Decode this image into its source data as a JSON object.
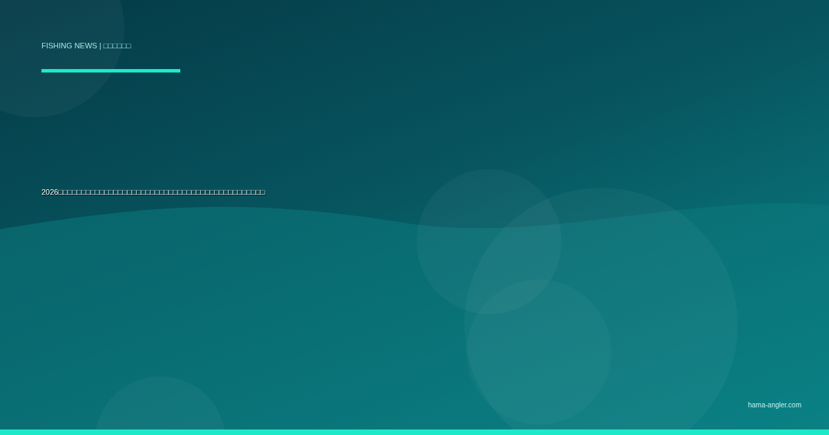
{
  "header": {
    "label": "FISHING NEWS | □□□□□□"
  },
  "headline": "2026□□□□□□□□□□□□□□□□□□□□□□□□□□□□□□□□□□□□□□□□□□□□□",
  "footer": {
    "site": "hama-angler.com"
  }
}
